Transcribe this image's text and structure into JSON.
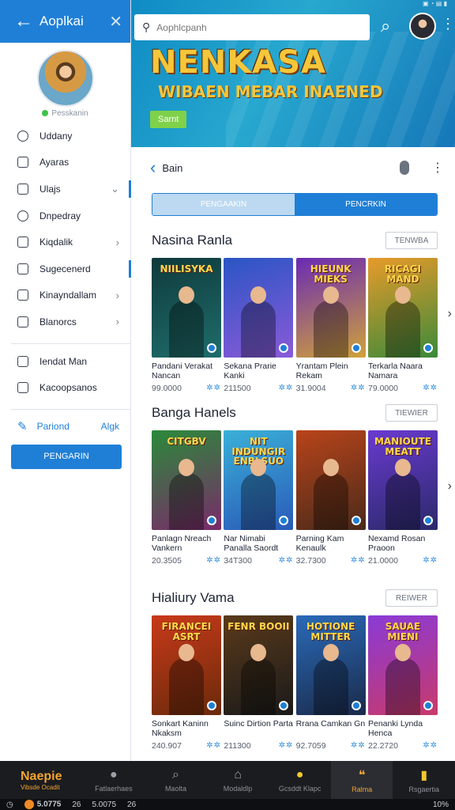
{
  "drawer": {
    "title": "Aoplkai",
    "status_label": "Pesskanin",
    "menu": [
      {
        "label": "Uddany",
        "icon": "toggle-icon",
        "chevron": false
      },
      {
        "label": "Ayaras",
        "icon": "document-icon",
        "chevron": false
      },
      {
        "label": "Ulajs",
        "icon": "image-icon",
        "chevron": true,
        "chevron_glyph": "⌄"
      },
      {
        "label": "Dnpedray",
        "icon": "clock-icon",
        "chevron": false
      },
      {
        "label": "Kiqdalik",
        "icon": "folder-icon",
        "chevron": true,
        "chevron_glyph": "›"
      },
      {
        "label": "Sugecenerd",
        "icon": "settings-icon",
        "chevron": false
      },
      {
        "label": "Kinayndallam",
        "icon": "list-icon",
        "chevron": true,
        "chevron_glyph": "›"
      },
      {
        "label": "Blanorcs",
        "icon": "box-icon",
        "chevron": true,
        "chevron_glyph": "›"
      }
    ],
    "menu2": [
      {
        "label": "Iendat Man",
        "icon": "calendar-icon"
      },
      {
        "label": "Kacoopsanos",
        "icon": "tag-icon"
      }
    ],
    "period_label": "Pariond",
    "period_value": "Algk",
    "button_label": "PENGARIN"
  },
  "top": {
    "search_placeholder": "Aophlcpanh",
    "hero_title": "NENKASA",
    "hero_subtitle": "WIBAEN MEBAR INAENED",
    "hero_button": "Sarnt"
  },
  "panel": {
    "back_label": "Bain",
    "tabs": [
      {
        "label": "PENGAAKIN",
        "active": true
      },
      {
        "label": "PENCRKIN",
        "active": false
      }
    ],
    "sections": [
      {
        "title": "Nasina Ranla",
        "button": "TENWBA",
        "items": [
          {
            "poster_title": "NIILISYKA",
            "name": "Pandani Verakat Nancan",
            "value": "99.0000",
            "colors": [
              "#0f3a3c",
              "#1f6d6b"
            ]
          },
          {
            "poster_title": "",
            "name": "Sekana Prarie Kanki",
            "value": "211500",
            "colors": [
              "#2a55c4",
              "#8a5ad8"
            ]
          },
          {
            "poster_title": "HIEUNK MIEKS",
            "name": "Yrantam Plein Rekam",
            "value": "31.9004",
            "colors": [
              "#6a2ab4",
              "#d0a23a"
            ]
          },
          {
            "poster_title": "RICAGI MAND",
            "name": "Terkarla Naara Namara",
            "value": "79.0000",
            "colors": [
              "#e89a2a",
              "#3a8a3a"
            ]
          }
        ]
      },
      {
        "title": "Banga Hanels",
        "button": "TIEWIER",
        "items": [
          {
            "poster_title": "CITGBV",
            "name": "Panlagn Nreach Vankern",
            "value": "20.3505",
            "colors": [
              "#2a8a3a",
              "#7a2a6a"
            ]
          },
          {
            "poster_title": "NIT INDUNGIR ENBLSUO",
            "name": "Nar Nimabi Panalla Saordt",
            "value": "34T300",
            "colors": [
              "#3ab0d8",
              "#2a5ab8"
            ]
          },
          {
            "poster_title": "",
            "name": "Parning Kam Kenaulk",
            "value": "32.7300",
            "colors": [
              "#b8441a",
              "#4a2a1a"
            ]
          },
          {
            "poster_title": "MANIOUTE MEATT",
            "name": "Nexamd Rosan Praoon",
            "value": "21.0000",
            "colors": [
              "#6a3ad0",
              "#2a2a6a"
            ]
          }
        ]
      },
      {
        "title": "Hialiury Vama",
        "button": "REIWER",
        "items": [
          {
            "poster_title": "FIRANCEI ASRT",
            "name": "Sonkart Kaninn Nkaksm",
            "value": "240.907",
            "colors": [
              "#c83a1a",
              "#6a2a0a"
            ]
          },
          {
            "poster_title": "FENR BOOII",
            "name": "Suinc Dirtion Parta",
            "value": "211300",
            "colors": [
              "#5a3a1a",
              "#1a1a1a"
            ]
          },
          {
            "poster_title": "HOTIONE MITTER",
            "name": "Rrana Camkan Gn",
            "value": "92.7059",
            "colors": [
              "#2a6ab8",
              "#1a2a4a"
            ]
          },
          {
            "poster_title": "SAUAE MIENI",
            "name": "Penanki Lynda Henca",
            "value": "22.2720",
            "colors": [
              "#8a3ad8",
              "#c83a6a"
            ]
          }
        ]
      }
    ]
  },
  "bottom_nav": {
    "brand": "Naepie",
    "brand_sub": "Vibsde Ocadit",
    "items": [
      {
        "label": "Fatlaerhaes",
        "icon": "person-icon",
        "glyph": "●"
      },
      {
        "label": "Maolta",
        "icon": "search-icon",
        "glyph": "⌕"
      },
      {
        "label": "Modaldlp",
        "icon": "home-icon",
        "glyph": "⌂"
      },
      {
        "label": "Gcsddt Klapc",
        "icon": "coin-icon",
        "glyph": "●"
      },
      {
        "label": "Ralma",
        "icon": "chat-icon",
        "glyph": "❝",
        "active": true
      },
      {
        "label": "Rsgaertia",
        "icon": "bookmark-icon",
        "glyph": "▮"
      }
    ]
  },
  "sysbar": {
    "left_value": "5.0775",
    "left_badge": "26",
    "mid_value": "5.0075",
    "mid_badge": "26",
    "battery": "10%"
  },
  "colors": {
    "accent": "#1f7fd6",
    "brand_gold": "#f2a531",
    "hero_title": "#f6c63a"
  }
}
